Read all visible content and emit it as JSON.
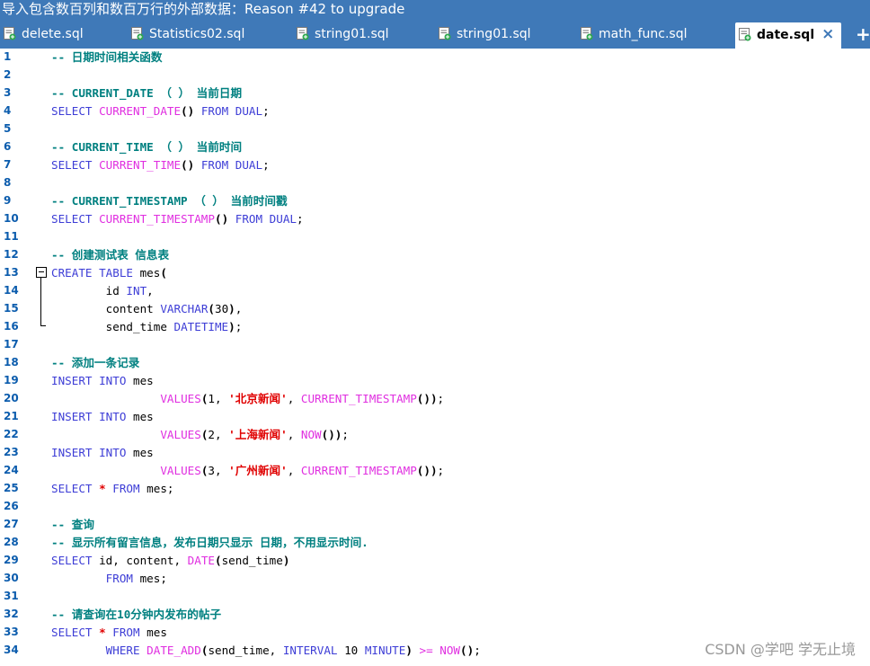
{
  "window": {
    "banner": "导入包含数百列和数百万行的外部数据：Reason #42 to upgrade"
  },
  "tabs": [
    {
      "label": "delete.sql",
      "icon": "sql-file-icon",
      "active": false
    },
    {
      "label": "Statistics02.sql",
      "icon": "sql-file-icon",
      "active": false
    },
    {
      "label": "string01.sql",
      "icon": "sql-file-icon",
      "active": false
    },
    {
      "label": "string01.sql",
      "icon": "sql-file-icon",
      "active": false
    },
    {
      "label": "math_func.sql",
      "icon": "sql-file-icon",
      "active": false
    },
    {
      "label": "date.sql",
      "icon": "sql-file-icon",
      "active": true
    }
  ],
  "tab_close_symbol": "×",
  "tab_add_symbol": "+",
  "colors": {
    "title_bar": "#3f79b8",
    "comment": "#008080",
    "keyword": "#3d3dd6",
    "function": "#e02fe0",
    "string": "#e00000",
    "line_number": "#0b5cad"
  },
  "editor": {
    "line_numbers": [
      "1",
      "2",
      "3",
      "4",
      "5",
      "6",
      "7",
      "8",
      "9",
      "10",
      "11",
      "12",
      "13",
      "14",
      "15",
      "16",
      "17",
      "18",
      "19",
      "20",
      "21",
      "22",
      "23",
      "24",
      "25",
      "26",
      "27",
      "28",
      "29",
      "30",
      "31",
      "32",
      "33",
      "34"
    ],
    "lines": [
      [
        {
          "t": "-- 日期时间相关函数",
          "c": "cm"
        }
      ],
      [],
      [
        {
          "t": "-- CURRENT_DATE （ ） 当前日期",
          "c": "cm"
        }
      ],
      [
        {
          "t": "SELECT ",
          "c": "kw"
        },
        {
          "t": "CURRENT_DATE",
          "c": "fn"
        },
        {
          "t": "() ",
          "c": "sym"
        },
        {
          "t": "FROM ",
          "c": "kw"
        },
        {
          "t": "DUAL",
          "c": "kw"
        },
        {
          "t": ";",
          "c": "id"
        }
      ],
      [],
      [
        {
          "t": "-- CURRENT_TIME （ ） 当前时间",
          "c": "cm"
        }
      ],
      [
        {
          "t": "SELECT ",
          "c": "kw"
        },
        {
          "t": "CURRENT_TIME",
          "c": "fn"
        },
        {
          "t": "() ",
          "c": "sym"
        },
        {
          "t": "FROM ",
          "c": "kw"
        },
        {
          "t": "DUAL",
          "c": "kw"
        },
        {
          "t": ";",
          "c": "id"
        }
      ],
      [],
      [
        {
          "t": "-- CURRENT_TIMESTAMP （ ） 当前时间戳",
          "c": "cm"
        }
      ],
      [
        {
          "t": "SELECT ",
          "c": "kw"
        },
        {
          "t": "CURRENT_TIMESTAMP",
          "c": "fn"
        },
        {
          "t": "() ",
          "c": "sym"
        },
        {
          "t": "FROM ",
          "c": "kw"
        },
        {
          "t": "DUAL",
          "c": "kw"
        },
        {
          "t": ";",
          "c": "id"
        }
      ],
      [],
      [
        {
          "t": "-- 创建测试表 信息表",
          "c": "cm"
        }
      ],
      [
        {
          "t": "CREATE ",
          "c": "kw"
        },
        {
          "t": "TABLE ",
          "c": "kw"
        },
        {
          "t": "mes",
          "c": "id"
        },
        {
          "t": "(",
          "c": "sym"
        }
      ],
      [
        {
          "t": "        id ",
          "c": "id"
        },
        {
          "t": "INT",
          "c": "kw"
        },
        {
          "t": ",",
          "c": "id"
        }
      ],
      [
        {
          "t": "        content ",
          "c": "id"
        },
        {
          "t": "VARCHAR",
          "c": "kw"
        },
        {
          "t": "(",
          "c": "sym"
        },
        {
          "t": "30",
          "c": "num"
        },
        {
          "t": ")",
          "c": "sym"
        },
        {
          "t": ",",
          "c": "id"
        }
      ],
      [
        {
          "t": "        send_time ",
          "c": "id"
        },
        {
          "t": "DATETIME",
          "c": "kw"
        },
        {
          "t": ")",
          "c": "sym"
        },
        {
          "t": ";",
          "c": "id"
        }
      ],
      [],
      [
        {
          "t": "-- 添加一条记录",
          "c": "cm"
        }
      ],
      [
        {
          "t": "INSERT ",
          "c": "kw"
        },
        {
          "t": "INTO ",
          "c": "kw"
        },
        {
          "t": "mes",
          "c": "id"
        }
      ],
      [
        {
          "t": "                ",
          "c": "id"
        },
        {
          "t": "VALUES",
          "c": "fn"
        },
        {
          "t": "(",
          "c": "sym"
        },
        {
          "t": "1, ",
          "c": "num"
        },
        {
          "t": "'北京新闻'",
          "c": "str"
        },
        {
          "t": ", ",
          "c": "id"
        },
        {
          "t": "CURRENT_TIMESTAMP",
          "c": "fn"
        },
        {
          "t": "())",
          "c": "sym"
        },
        {
          "t": ";",
          "c": "id"
        }
      ],
      [
        {
          "t": "INSERT ",
          "c": "kw"
        },
        {
          "t": "INTO ",
          "c": "kw"
        },
        {
          "t": "mes",
          "c": "id"
        }
      ],
      [
        {
          "t": "                ",
          "c": "id"
        },
        {
          "t": "VALUES",
          "c": "fn"
        },
        {
          "t": "(",
          "c": "sym"
        },
        {
          "t": "2, ",
          "c": "num"
        },
        {
          "t": "'上海新闻'",
          "c": "str"
        },
        {
          "t": ", ",
          "c": "id"
        },
        {
          "t": "NOW",
          "c": "fn"
        },
        {
          "t": "())",
          "c": "sym"
        },
        {
          "t": ";",
          "c": "id"
        }
      ],
      [
        {
          "t": "INSERT ",
          "c": "kw"
        },
        {
          "t": "INTO ",
          "c": "kw"
        },
        {
          "t": "mes",
          "c": "id"
        }
      ],
      [
        {
          "t": "                ",
          "c": "id"
        },
        {
          "t": "VALUES",
          "c": "fn"
        },
        {
          "t": "(",
          "c": "sym"
        },
        {
          "t": "3, ",
          "c": "num"
        },
        {
          "t": "'广州新闻'",
          "c": "str"
        },
        {
          "t": ", ",
          "c": "id"
        },
        {
          "t": "CURRENT_TIMESTAMP",
          "c": "fn"
        },
        {
          "t": "())",
          "c": "sym"
        },
        {
          "t": ";",
          "c": "id"
        }
      ],
      [
        {
          "t": "SELECT ",
          "c": "kw"
        },
        {
          "t": "* ",
          "c": "str"
        },
        {
          "t": "FROM ",
          "c": "kw"
        },
        {
          "t": "mes",
          "c": "id"
        },
        {
          "t": ";",
          "c": "id"
        }
      ],
      [],
      [
        {
          "t": "-- 查询",
          "c": "cm"
        }
      ],
      [
        {
          "t": "-- 显示所有留言信息，发布日期只显示 日期，不用显示时间.",
          "c": "cm"
        }
      ],
      [
        {
          "t": "SELECT ",
          "c": "kw"
        },
        {
          "t": "id, content, ",
          "c": "id"
        },
        {
          "t": "DATE",
          "c": "fn"
        },
        {
          "t": "(",
          "c": "sym"
        },
        {
          "t": "send_time",
          "c": "id"
        },
        {
          "t": ")",
          "c": "sym"
        }
      ],
      [
        {
          "t": "        ",
          "c": "id"
        },
        {
          "t": "FROM ",
          "c": "kw"
        },
        {
          "t": "mes",
          "c": "id"
        },
        {
          "t": ";",
          "c": "id"
        }
      ],
      [],
      [
        {
          "t": "-- 请查询在10分钟内发布的帖子",
          "c": "cm"
        }
      ],
      [
        {
          "t": "SELECT ",
          "c": "kw"
        },
        {
          "t": "* ",
          "c": "str"
        },
        {
          "t": "FROM ",
          "c": "kw"
        },
        {
          "t": "mes",
          "c": "id"
        }
      ],
      [
        {
          "t": "        ",
          "c": "id"
        },
        {
          "t": "WHERE ",
          "c": "kw"
        },
        {
          "t": "DATE_ADD",
          "c": "fn"
        },
        {
          "t": "(",
          "c": "sym"
        },
        {
          "t": "send_time, ",
          "c": "id"
        },
        {
          "t": "INTERVAL ",
          "c": "kw"
        },
        {
          "t": "10 ",
          "c": "num"
        },
        {
          "t": "MINUTE",
          "c": "kw"
        },
        {
          "t": ") ",
          "c": "sym"
        },
        {
          "t": ">= ",
          "c": "fn"
        },
        {
          "t": "NOW",
          "c": "fn"
        },
        {
          "t": "()",
          "c": "sym"
        },
        {
          "t": ";",
          "c": "id"
        }
      ]
    ]
  },
  "watermark": "CSDN @学吧 学无止境"
}
